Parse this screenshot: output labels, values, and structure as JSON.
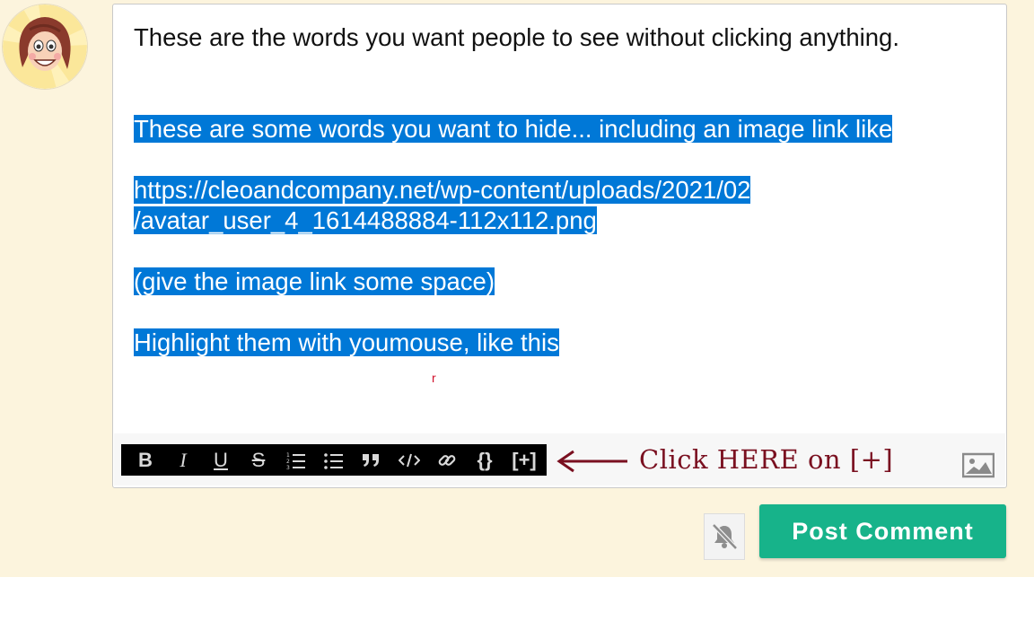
{
  "comment": {
    "intro_line": "These are the words you want people to see without clicking anything.",
    "hidden_text": {
      "line1": "These are some words you want to hide... including an image link like ",
      "url_part1": "https://cleoandcompany.net/wp-content/uploads/2021/02",
      "url_part2": "/avatar_user_4_1614488884-112x112.png",
      "line3": "(give the image link some space)",
      "line4_start": "Highlight  them with you",
      "line4_end": "mouse, like this",
      "caret_glyph": "r"
    }
  },
  "toolbar": {
    "buttons": [
      {
        "label": "B",
        "icon": "bold-icon"
      },
      {
        "label": "I",
        "icon": "italic-icon"
      },
      {
        "label": "U",
        "icon": "underline-icon"
      },
      {
        "label": "S",
        "icon": "strikethrough-icon"
      },
      {
        "label": "",
        "icon": "ordered-list-icon"
      },
      {
        "label": "",
        "icon": "unordered-list-icon"
      },
      {
        "label": "",
        "icon": "blockquote-icon"
      },
      {
        "label": "",
        "icon": "code-icon"
      },
      {
        "label": "",
        "icon": "link-icon"
      },
      {
        "label": "{}",
        "icon": "code-block-icon"
      },
      {
        "label": "[+]",
        "icon": "spoiler-icon"
      }
    ]
  },
  "annotation": {
    "text": "Click HERE on [+]",
    "color": "#7a1020"
  },
  "actions": {
    "post_label": "Post Comment",
    "post_color": "#17b38a"
  },
  "colors": {
    "page_background": "#fcf4dd",
    "selection_highlight": "#0078d7"
  }
}
